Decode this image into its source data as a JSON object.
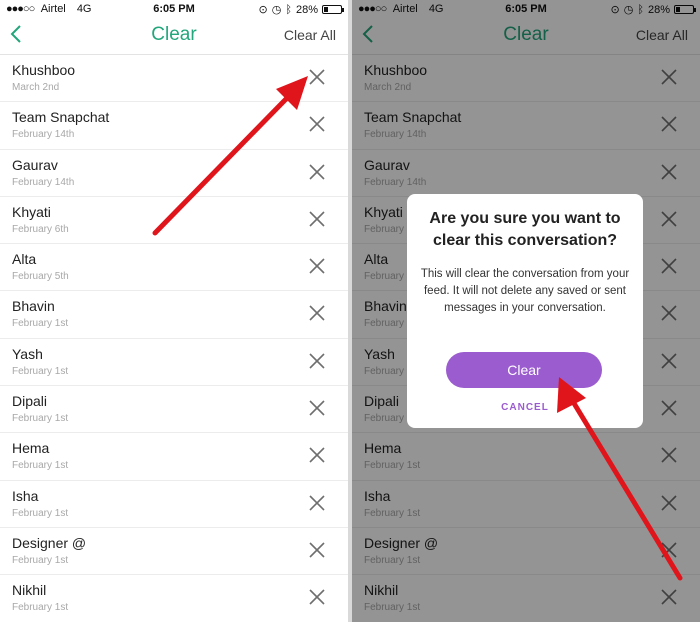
{
  "status_bar": {
    "carrier": "Airtel",
    "network": "4G",
    "time": "6:05 PM",
    "battery": "28%",
    "battery_level": 0.28
  },
  "nav": {
    "back_icon": "chevron-left-icon",
    "title": "Clear",
    "clear_all": "Clear All"
  },
  "conversations": [
    {
      "name": "Khushboo",
      "date": "March 2nd"
    },
    {
      "name": "Team Snapchat",
      "date": "February 14th"
    },
    {
      "name": "Gaurav",
      "date": "February 14th"
    },
    {
      "name": "Khyati",
      "date": "February 6th"
    },
    {
      "name": "Alta",
      "date": "February 5th"
    },
    {
      "name": "Bhavin",
      "date": "February 1st"
    },
    {
      "name": "Yash",
      "date": "February 1st"
    },
    {
      "name": "Dipali",
      "date": "February 1st"
    },
    {
      "name": "Hema",
      "date": "February 1st"
    },
    {
      "name": "Isha",
      "date": "February 1st"
    },
    {
      "name": "Designer @",
      "date": "February 1st"
    },
    {
      "name": "Nikhil",
      "date": "February 1st"
    }
  ],
  "dialog": {
    "title": "Are you sure you want to clear this conversation?",
    "message": "This will clear the conversation from your feed. It will not delete any saved or sent messages in your conversation.",
    "confirm": "Clear",
    "cancel": "CANCEL"
  },
  "colors": {
    "accent_green": "#23a67c",
    "button_purple": "#9b5ccf",
    "arrow_red": "#e0141b"
  }
}
